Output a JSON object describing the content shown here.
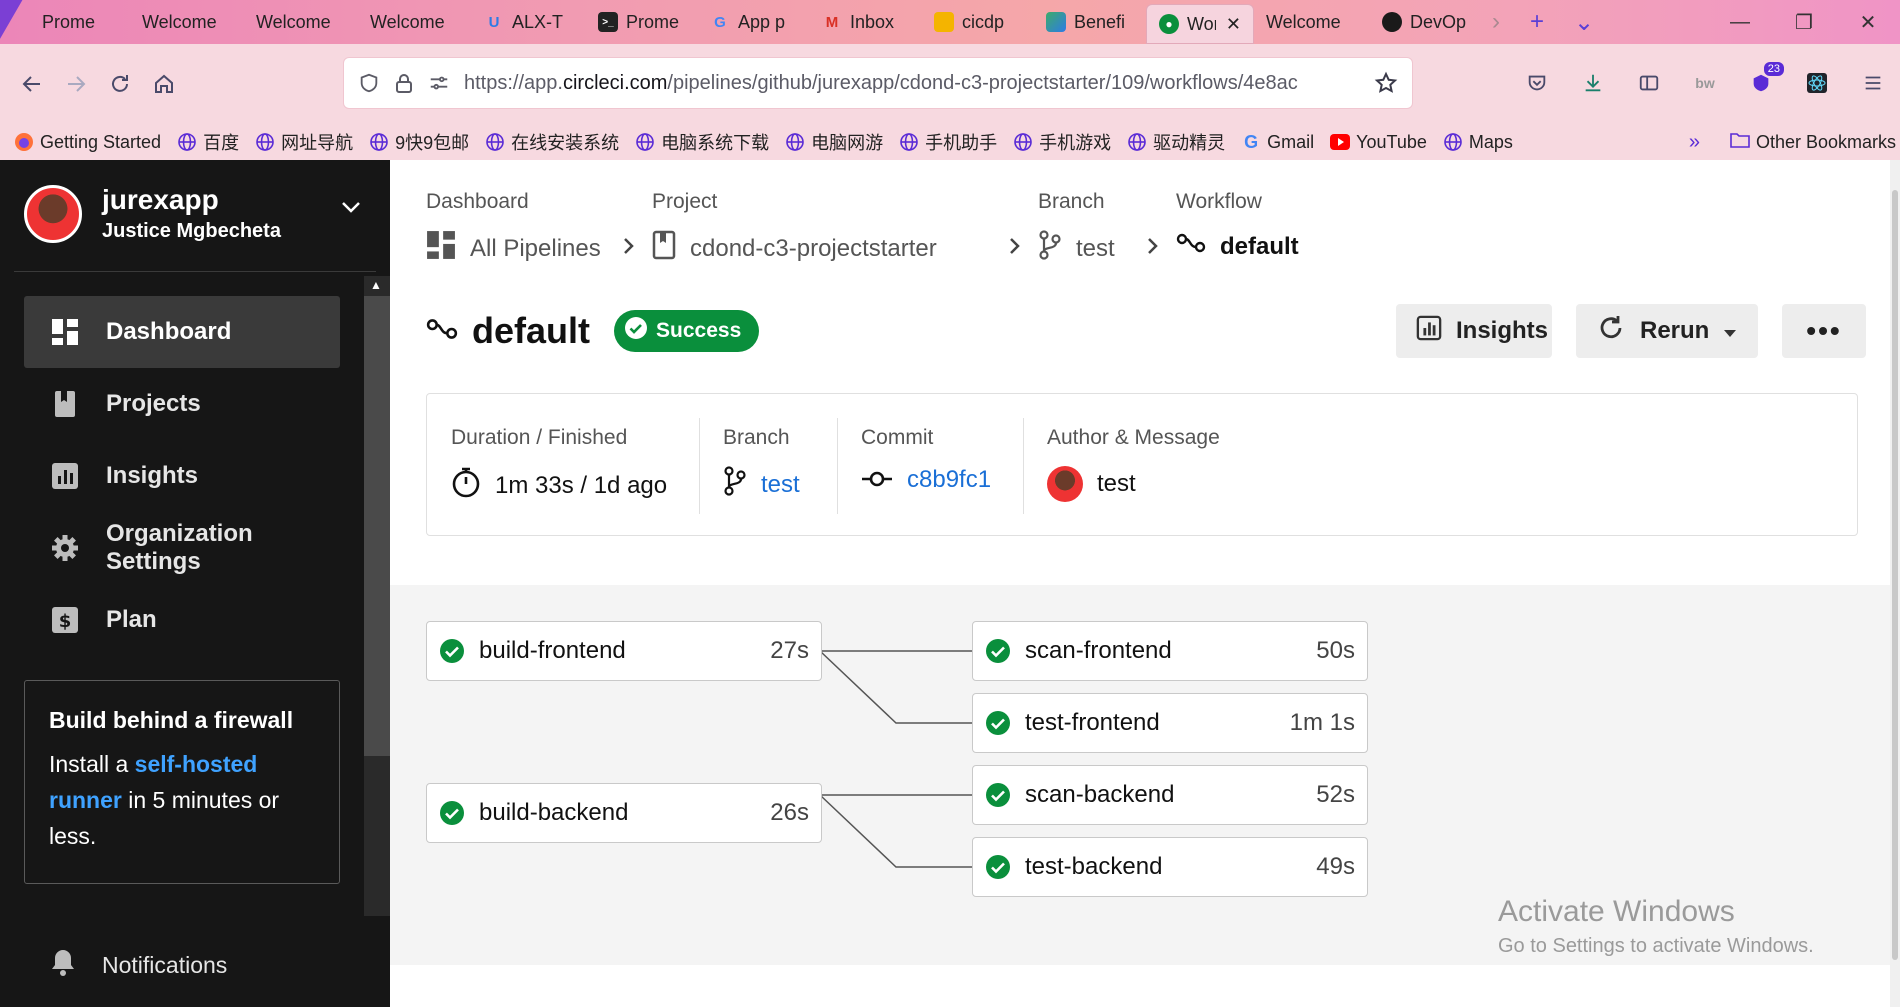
{
  "browser": {
    "tabs": [
      {
        "label": "Prome",
        "icon": "dark-favicon",
        "color": "#ffffff"
      },
      {
        "label": "Welcome",
        "icon": "none",
        "color": ""
      },
      {
        "label": "Welcome",
        "icon": "none",
        "color": ""
      },
      {
        "label": "Welcome",
        "icon": "none",
        "color": ""
      },
      {
        "label": "ALX-T",
        "icon": "udacity-icon",
        "color": "#2d7be5"
      },
      {
        "label": "Prome",
        "icon": "terminal-icon",
        "color": "#1a1a1a"
      },
      {
        "label": "App p",
        "icon": "google-icon",
        "color": "#4285f4"
      },
      {
        "label": "Inbox",
        "icon": "gmail-icon",
        "color": "#d93025"
      },
      {
        "label": "cicdp",
        "icon": "slides-icon",
        "color": "#f4b400"
      },
      {
        "label": "Benefi",
        "icon": "kotlin-icon",
        "color": "#3dab6a"
      },
      {
        "label": "Wor",
        "icon": "circleci-icon",
        "color": "#0a8f3c",
        "active": true
      },
      {
        "label": "Welcome",
        "icon": "none",
        "color": ""
      },
      {
        "label": "DevOp",
        "icon": "github-icon",
        "color": "#1a1a1a"
      }
    ],
    "active_tab_close": "✕",
    "new_tab": "+",
    "tab_list": "⌄",
    "url_prefix": "https://app.",
    "url_domain": "circleci.com",
    "url_path": "/pipelines/github/jurexapp/cdond-c3-projectstarter/109/workflows/4e8ac",
    "extension_badge": "23",
    "bookmarks": [
      {
        "label": "Getting Started",
        "icon": "firefox-icon"
      },
      {
        "label": "百度",
        "icon": "globe-icon"
      },
      {
        "label": "网址导航",
        "icon": "globe-icon"
      },
      {
        "label": "9快9包邮",
        "icon": "globe-icon"
      },
      {
        "label": "在线安装系统",
        "icon": "globe-icon"
      },
      {
        "label": "电脑系统下载",
        "icon": "globe-icon"
      },
      {
        "label": "电脑网游",
        "icon": "globe-icon"
      },
      {
        "label": "手机助手",
        "icon": "globe-icon"
      },
      {
        "label": "手机游戏",
        "icon": "globe-icon"
      },
      {
        "label": "驱动精灵",
        "icon": "globe-icon"
      },
      {
        "label": "Gmail",
        "icon": "google-icon"
      },
      {
        "label": "YouTube",
        "icon": "youtube-icon"
      },
      {
        "label": "Maps",
        "icon": "globe-icon"
      }
    ],
    "other_bookmarks": "Other Bookmarks"
  },
  "sidebar": {
    "username": "jurexapp",
    "fullname": "Justice Mgbecheta",
    "nav": [
      {
        "label": "Dashboard",
        "icon": "dashboard-icon",
        "active": true
      },
      {
        "label": "Projects",
        "icon": "projects-icon"
      },
      {
        "label": "Insights",
        "icon": "insights-icon"
      },
      {
        "label": "Organization Settings",
        "icon": "gear-icon"
      },
      {
        "label": "Plan",
        "icon": "dollar-icon"
      }
    ],
    "promo": {
      "title": "Build behind a firewall",
      "pre": "Install a ",
      "link": "self-hosted runner",
      "post": " in 5 minutes or less."
    },
    "notifications": "Notifications"
  },
  "breadcrumb": {
    "dashboard_label": "Dashboard",
    "dashboard_value": "All Pipelines",
    "project_label": "Project",
    "project_value": "cdond-c3-projectstarter",
    "branch_label": "Branch",
    "branch_value": "test",
    "workflow_label": "Workflow",
    "workflow_value": "default"
  },
  "workflow": {
    "title": "default",
    "status": "Success",
    "status_color": "#0a8f3c",
    "actions": {
      "insights": "Insights",
      "rerun": "Rerun",
      "more": "•••"
    }
  },
  "summary": {
    "duration_label": "Duration / Finished",
    "duration_value": "1m 33s / 1d ago",
    "branch_label": "Branch",
    "branch_value": "test",
    "commit_label": "Commit",
    "commit_value": "c8b9fc1",
    "author_label": "Author & Message",
    "message": "test"
  },
  "jobs": [
    {
      "name": "build-frontend",
      "duration": "27s",
      "status": "success"
    },
    {
      "name": "scan-frontend",
      "duration": "50s",
      "status": "success"
    },
    {
      "name": "test-frontend",
      "duration": "1m 1s",
      "status": "success"
    },
    {
      "name": "build-backend",
      "duration": "26s",
      "status": "success"
    },
    {
      "name": "scan-backend",
      "duration": "52s",
      "status": "success"
    },
    {
      "name": "test-backend",
      "duration": "49s",
      "status": "success"
    }
  ],
  "watermark": {
    "title": "Activate Windows",
    "subtitle": "Go to Settings to activate Windows."
  }
}
